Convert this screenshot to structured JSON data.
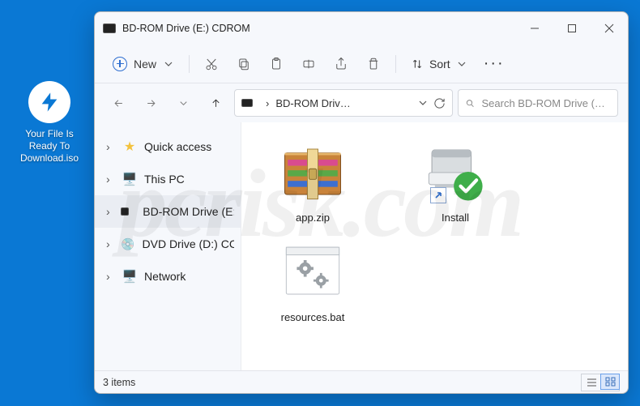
{
  "desktop": {
    "icon_label": "Your File Is Ready To Download.iso"
  },
  "window": {
    "title": "BD-ROM Drive (E:) CDROM",
    "toolbar": {
      "new_label": "New",
      "sort_label": "Sort"
    },
    "address": {
      "path_display": "BD-ROM Driv…"
    },
    "search": {
      "placeholder": "Search BD-ROM Drive (E:) CD…"
    },
    "sidebar": {
      "items": [
        {
          "label": "Quick access"
        },
        {
          "label": "This PC"
        },
        {
          "label": "BD-ROM Drive (E:) C"
        },
        {
          "label": "DVD Drive (D:) CCCC"
        },
        {
          "label": "Network"
        }
      ]
    },
    "files": [
      {
        "name": "app.zip"
      },
      {
        "name": "Install"
      },
      {
        "name": "resources.bat"
      }
    ],
    "status": {
      "count_text": "3 items"
    }
  },
  "watermark": "pcrisk.com"
}
